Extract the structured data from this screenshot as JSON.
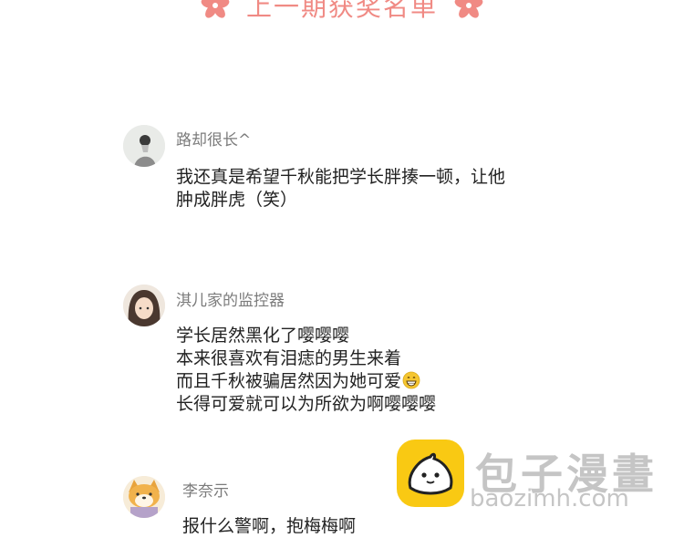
{
  "header": {
    "title": "上一期获奖名单",
    "accent_color": "#f08a84"
  },
  "comments": [
    {
      "username": "路却很长^",
      "avatar_icon": "avatar-woman-sketch",
      "lines": [
        "我还真是希望千秋能把学长胖揍一顿，让他",
        "肿成胖虎（笑）"
      ]
    },
    {
      "username": "淇儿家的监控器",
      "avatar_icon": "avatar-anime-girl",
      "lines": [
        "学长居然黑化了嘤嘤嘤",
        "本来很喜欢有泪痣的男生来着",
        "而且千秋被骗居然因为她可爱",
        "长得可爱就可以为所欲为啊嘤嘤嘤"
      ],
      "emoji_after_line_3": "grin-emoji"
    },
    {
      "username": "李奈示",
      "avatar_icon": "avatar-shiba-dog",
      "lines": [
        "报什么警啊，抱梅梅啊"
      ]
    }
  ],
  "watermark": {
    "text_cn": "包子漫畫",
    "url": "baozimh.com",
    "logo_icon": "bun-logo-icon",
    "logo_color": "#f9c913"
  }
}
